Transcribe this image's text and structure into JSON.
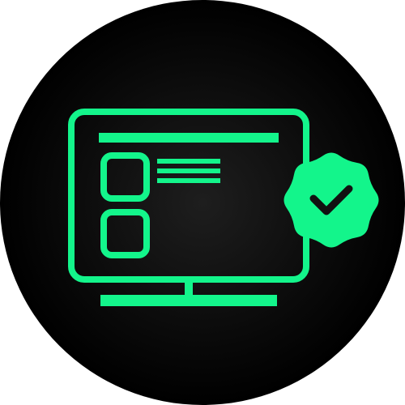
{
  "icon": {
    "name": "verified-monitor-icon",
    "description_words": [],
    "colors": {
      "accent": "#13f58b",
      "background_center": "#1e1e1e",
      "background_edge": "#000000",
      "check": "#111111"
    }
  }
}
